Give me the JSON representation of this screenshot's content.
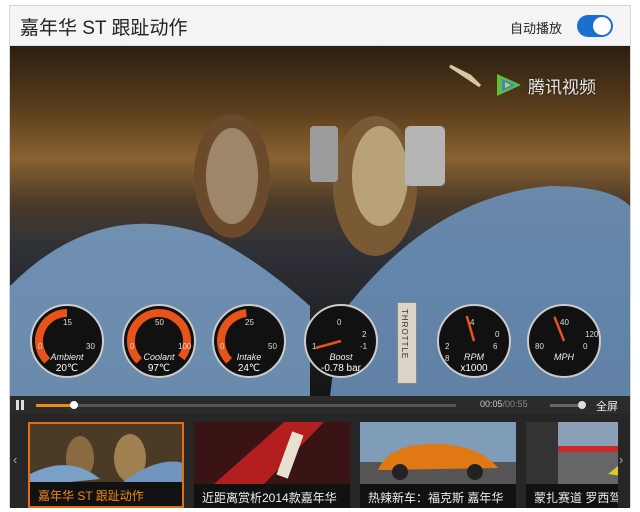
{
  "header": {
    "title": "嘉年华 ST 跟趾动作",
    "autoplay_label": "自动播放",
    "autoplay_on": true
  },
  "video": {
    "watermark": "腾讯视频",
    "gauges": [
      {
        "name": "ambient",
        "label": "Ambient",
        "value": "20℃",
        "ticks": [
          "15",
          "0",
          "30"
        ],
        "level": 0.5,
        "accent": "#e8531a"
      },
      {
        "name": "coolant",
        "label": "Coolant",
        "value": "97℃",
        "ticks": [
          "50",
          "0",
          "100"
        ],
        "level": 0.97,
        "accent": "#e8531a"
      },
      {
        "name": "intake",
        "label": "Intake",
        "value": "24℃",
        "ticks": [
          "25",
          "0",
          "50"
        ],
        "level": 0.48,
        "accent": "#e8531a"
      },
      {
        "name": "boost",
        "label": "Boost",
        "value": "-0.78 bar",
        "ticks": [
          "0",
          "1",
          "-1",
          "2"
        ],
        "level": 0.11,
        "accent": "#e8531a"
      },
      {
        "name": "rpm",
        "label": "RPM",
        "value": "x1000",
        "ticks": [
          "4",
          "2",
          "6",
          "0",
          "8"
        ],
        "level": 0.44,
        "accent": "#e8531a"
      },
      {
        "name": "mph",
        "label": "MPH",
        "value": "",
        "ticks": [
          "40",
          "80",
          "0",
          "120"
        ],
        "level": 0.42,
        "accent": "#e8531a"
      }
    ],
    "throttle_label": "THROTTLE"
  },
  "controls": {
    "current_time": "00:05",
    "duration": "00:55",
    "progress": 0.09,
    "fullscreen_label": "全屏"
  },
  "playlist": [
    {
      "title": "嘉年华 ST 跟趾动作",
      "active": true
    },
    {
      "title": "近距离赏析2014款嘉年华",
      "active": false
    },
    {
      "title": "热辣新车：福克斯 嘉年华",
      "active": false
    },
    {
      "title": "蒙扎赛道 罗西驾",
      "active": false
    }
  ],
  "colors": {
    "accent": "#f08a14",
    "toggle": "#1a6fd0"
  }
}
